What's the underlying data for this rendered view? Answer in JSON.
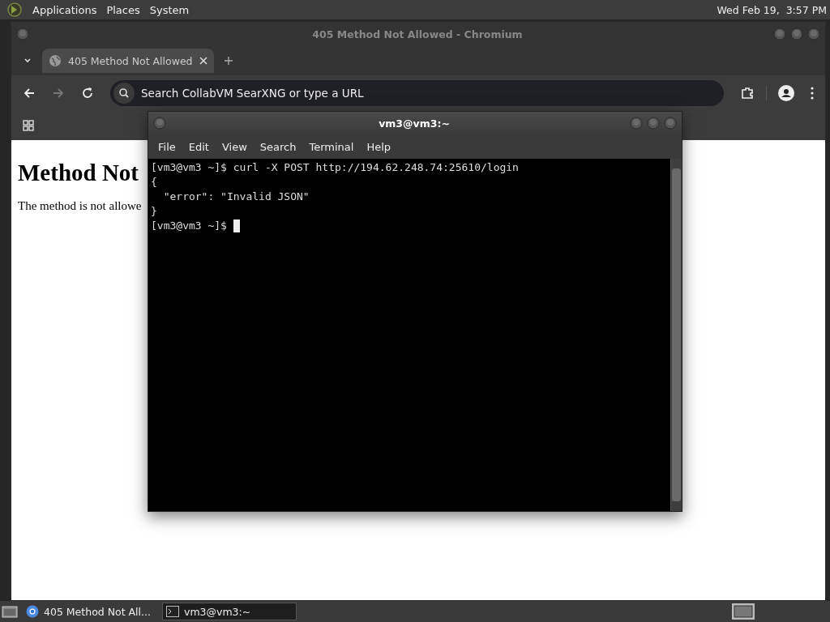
{
  "top_panel": {
    "menus": [
      "Applications",
      "Places",
      "System"
    ],
    "clock": "Wed Feb 19,  3:57 PM"
  },
  "browser": {
    "title": "405 Method Not Allowed - Chromium",
    "tabs": [
      {
        "label": "405 Method Not Allowed",
        "selected": true
      }
    ],
    "address_bar": {
      "placeholder": "Search CollabVM SearXNG or type a URL"
    },
    "page": {
      "heading": "Method Not",
      "text": "The method is not allowe"
    }
  },
  "terminal": {
    "title": "vm3@vm3:~",
    "menu": [
      "File",
      "Edit",
      "View",
      "Search",
      "Terminal",
      "Help"
    ],
    "lines": [
      "[vm3@vm3 ~]$ curl -X POST http://194.62.248.74:25610/login",
      "{",
      "  \"error\": \"Invalid JSON\"",
      "}",
      "[vm3@vm3 ~]$ "
    ],
    "cursor_visible": true
  },
  "taskbar": {
    "tasks": [
      {
        "label": "405 Method Not All...",
        "kind": "browser",
        "selected": false
      },
      {
        "label": "vm3@vm3:~",
        "kind": "terminal",
        "selected": true
      }
    ]
  }
}
